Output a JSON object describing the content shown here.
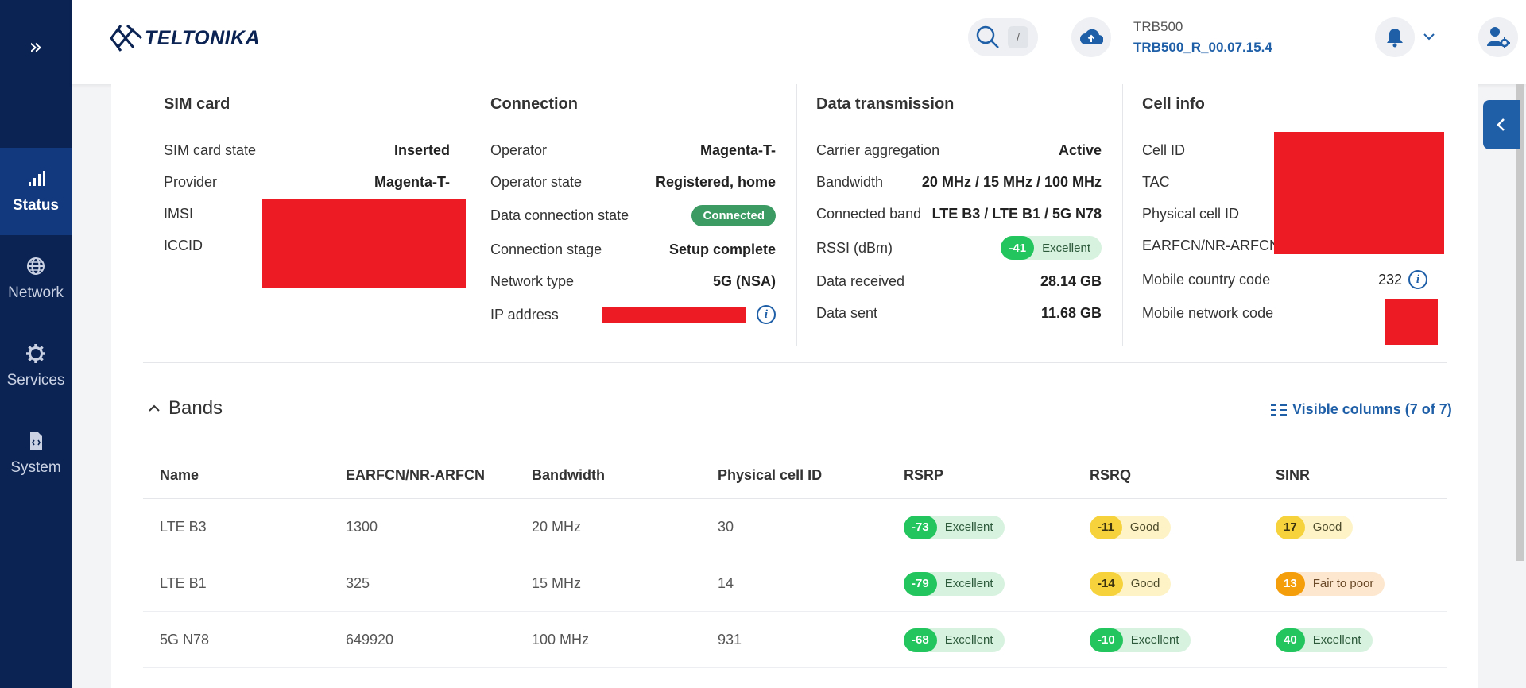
{
  "sidebar": {
    "toggle_icon": "double-chevron-right-icon",
    "items": [
      {
        "label": "Status",
        "icon": "signal-bars-icon",
        "active": true
      },
      {
        "label": "Network",
        "icon": "globe-icon",
        "active": false
      },
      {
        "label": "Services",
        "icon": "gear-icon",
        "active": false
      },
      {
        "label": "System",
        "icon": "file-code-icon",
        "active": false
      }
    ]
  },
  "header": {
    "logo_text": "TELTONIKA",
    "search_shortcut": "/",
    "device_name": "TRB500",
    "firmware": "TRB500_R_00.07.15.4"
  },
  "sim_card": {
    "title": "SIM card",
    "rows": [
      {
        "label": "SIM card state",
        "value": "Inserted"
      },
      {
        "label": "Provider",
        "value": "Magenta-T-"
      },
      {
        "label": "IMSI",
        "value": ""
      },
      {
        "label": "ICCID",
        "value": ""
      }
    ]
  },
  "connection": {
    "title": "Connection",
    "rows": [
      {
        "label": "Operator",
        "value": "Magenta-T-"
      },
      {
        "label": "Operator state",
        "value": "Registered, home"
      },
      {
        "label": "Data connection state",
        "value": "Connected"
      },
      {
        "label": "Connection stage",
        "value": "Setup complete"
      },
      {
        "label": "Network type",
        "value": "5G (NSA)"
      },
      {
        "label": "IP address",
        "value": ""
      }
    ]
  },
  "data_transmission": {
    "title": "Data transmission",
    "rows": [
      {
        "label": "Carrier aggregation",
        "value": "Active"
      },
      {
        "label": "Bandwidth",
        "value": "20 MHz / 15 MHz / 100 MHz"
      },
      {
        "label": "Connected band",
        "value": "LTE B3 / LTE B1 / 5G N78"
      },
      {
        "label": "RSSI (dBm)",
        "value": "-41",
        "quality": "Excellent"
      },
      {
        "label": "Data received",
        "value": "28.14 GB"
      },
      {
        "label": "Data sent",
        "value": "11.68 GB"
      }
    ]
  },
  "cell_info": {
    "title": "Cell info",
    "rows": [
      {
        "label": "Cell ID",
        "value": ""
      },
      {
        "label": "TAC",
        "value": ""
      },
      {
        "label": "Physical cell ID",
        "value": ""
      },
      {
        "label": "EARFCN/NR-ARFCN",
        "value": ""
      },
      {
        "label": "Mobile country code",
        "value": "232"
      },
      {
        "label": "Mobile network code",
        "value": ""
      }
    ]
  },
  "bands": {
    "title": "Bands",
    "visible_columns": "Visible columns (7 of 7)",
    "columns": [
      "Name",
      "EARFCN/NR-ARFCN",
      "Bandwidth",
      "Physical cell ID",
      "RSRP",
      "RSRQ",
      "SINR"
    ],
    "rows": [
      {
        "name": "LTE B3",
        "earfcn": "1300",
        "bandwidth": "20 MHz",
        "pci": "30",
        "rsrp": "-73",
        "rsrp_q": "Excellent",
        "rsrq": "-11",
        "rsrq_q": "Good",
        "sinr": "17",
        "sinr_q": "Good"
      },
      {
        "name": "LTE B1",
        "earfcn": "325",
        "bandwidth": "15 MHz",
        "pci": "14",
        "rsrp": "-79",
        "rsrp_q": "Excellent",
        "rsrq": "-14",
        "rsrq_q": "Good",
        "sinr": "13",
        "sinr_q": "Fair to poor"
      },
      {
        "name": "5G N78",
        "earfcn": "649920",
        "bandwidth": "100 MHz",
        "pci": "931",
        "rsrp": "-68",
        "rsrp_q": "Excellent",
        "rsrq": "-10",
        "rsrq_q": "Excellent",
        "sinr": "40",
        "sinr_q": "Excellent"
      }
    ]
  },
  "colors": {
    "sidebar_bg": "#0b2353",
    "accent": "#1e5fa8",
    "excellent": "#22c55e",
    "good": "#f6d33c",
    "fair": "#f59e0b",
    "redaction": "#ed1c24"
  }
}
